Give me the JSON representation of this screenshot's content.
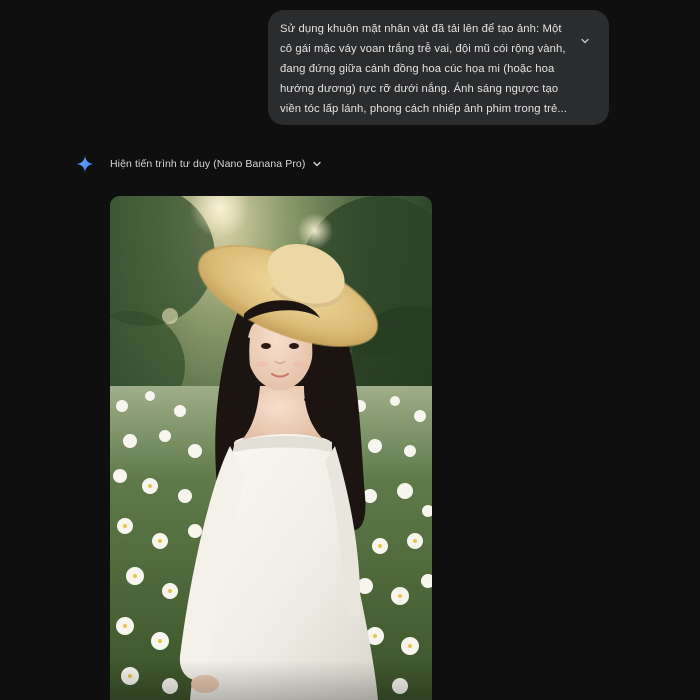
{
  "conversation": {
    "user_prompt": {
      "text": "Sử dụng khuôn mặt nhân vật đã tải lên để tạo ảnh: Một cô gái mặc váy voan trắng trễ vai, đội mũ cói rộng vành, đang đứng giữa cánh đồng hoa cúc họa mi (hoặc hoa hướng dương) rực rỡ dưới nắng. Ánh sáng ngược tạo viền tóc lấp lánh, phong cách nhiếp ảnh phim trong trẻ...",
      "expand_icon": "chevron-down-icon"
    },
    "response": {
      "model_icon": "gemini-spark-icon",
      "accent_color": "#4a8cff",
      "thinking_label": "Hiện tiến trình tư duy (Nano Banana Pro)",
      "thinking_toggle_icon": "chevron-down-icon"
    }
  }
}
